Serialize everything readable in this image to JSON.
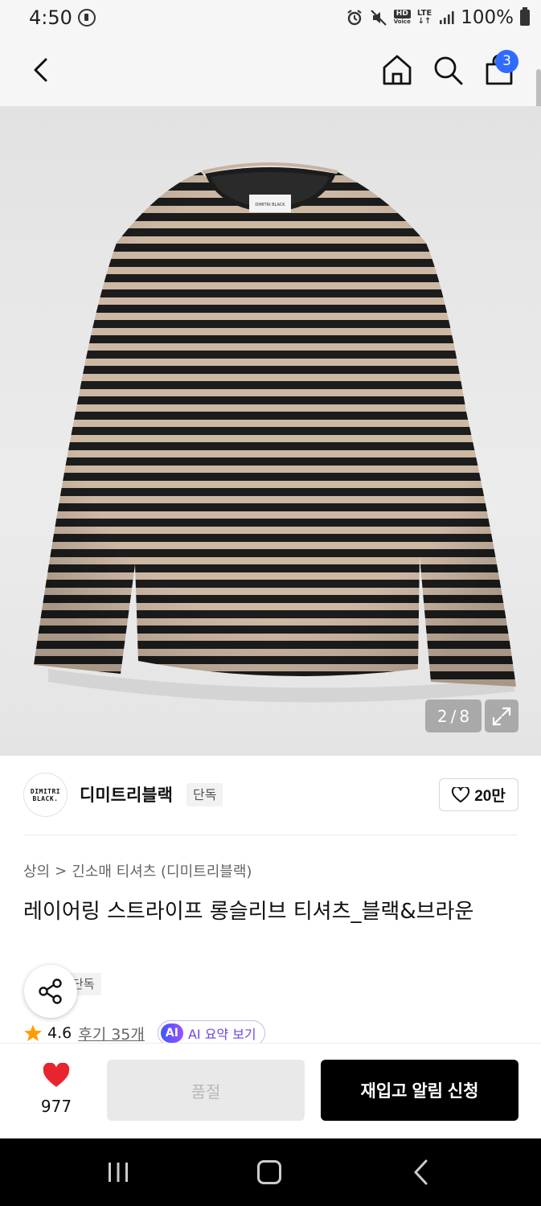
{
  "status_bar": {
    "time": "4:50",
    "hd_label": "HD",
    "voice_label": "Voice",
    "lte_label": "LTE",
    "battery": "100%"
  },
  "header": {
    "cart_count": "3"
  },
  "gallery": {
    "current": "2",
    "separator": "/",
    "total": "8",
    "neck_label": "DIMITRI BLACK"
  },
  "brand": {
    "logo_line1": "DIMITRI",
    "logo_line2": "BLACK.",
    "name": "디미트리블랙",
    "tag": "단독",
    "likes": "20만"
  },
  "breadcrumb": {
    "category": "상의",
    "separator": ">",
    "subcategory": "긴소매 티셔츠 (디미트리블랙)"
  },
  "product": {
    "title": "레이어링 스트라이프 롱슬리브 티셔츠_블랙&브라운",
    "exclusive_tag": "단독",
    "rating": "4.6",
    "reviews": "후기 35개",
    "ai_badge": "AI",
    "ai_summary": "AI 요약 보기"
  },
  "bottom_bar": {
    "wish_count": "977",
    "soldout_label": "품절",
    "restock_label": "재입고 알림 신청"
  },
  "colors": {
    "accent_blue": "#2f6bff",
    "heart_red": "#e8242f",
    "star_orange": "#ff9d00",
    "ai_purple": "#6b44e8",
    "stripe_dark": "#1c1c1c",
    "stripe_beige": "#cdb8a4"
  }
}
